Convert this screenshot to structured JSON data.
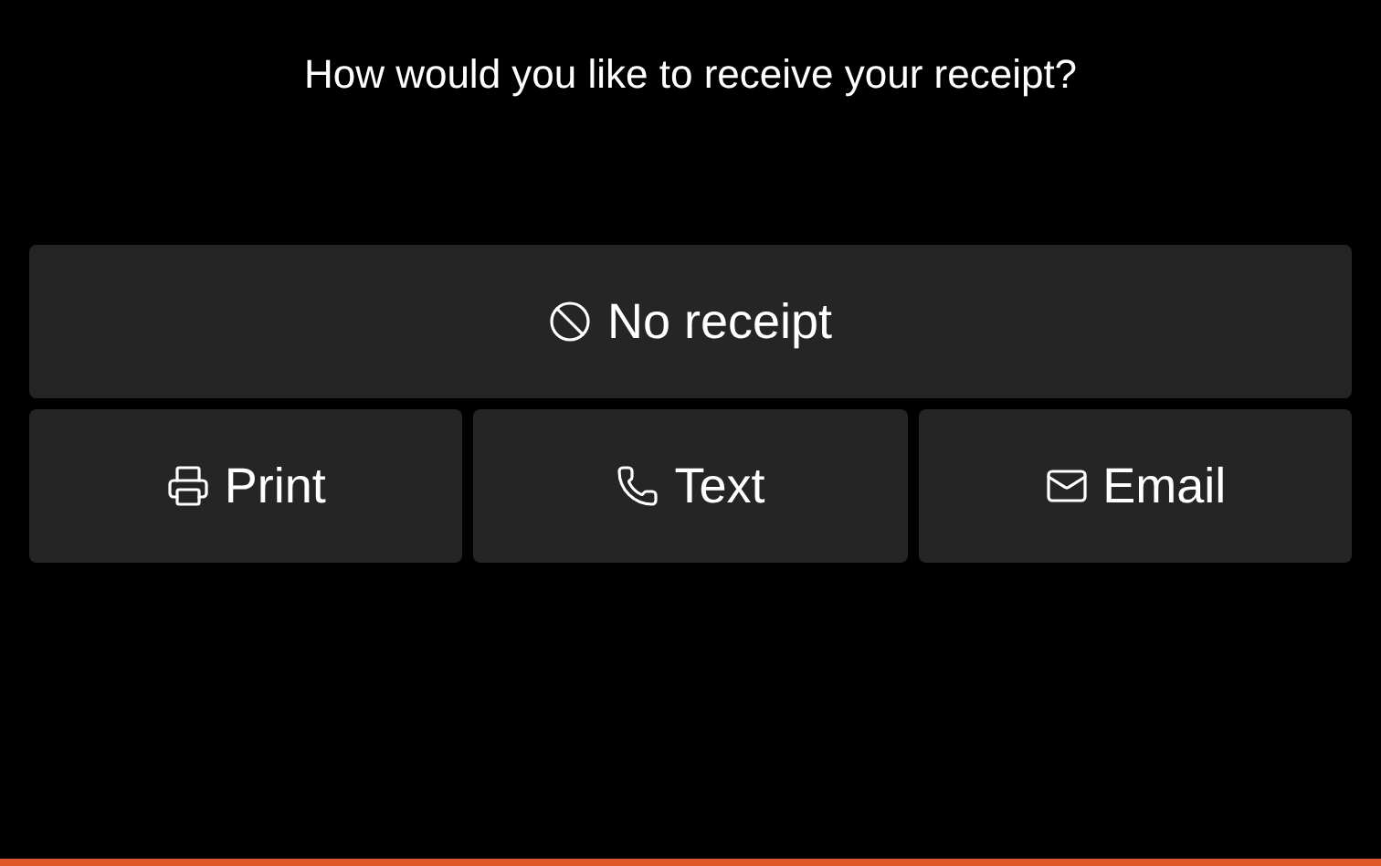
{
  "prompt": "How would you like to receive your receipt?",
  "primary_option": {
    "label": "No receipt",
    "kind": "none"
  },
  "options": [
    {
      "label": "Print",
      "kind": "print"
    },
    {
      "label": "Text",
      "kind": "phone"
    },
    {
      "label": "Email",
      "kind": "mail"
    }
  ]
}
